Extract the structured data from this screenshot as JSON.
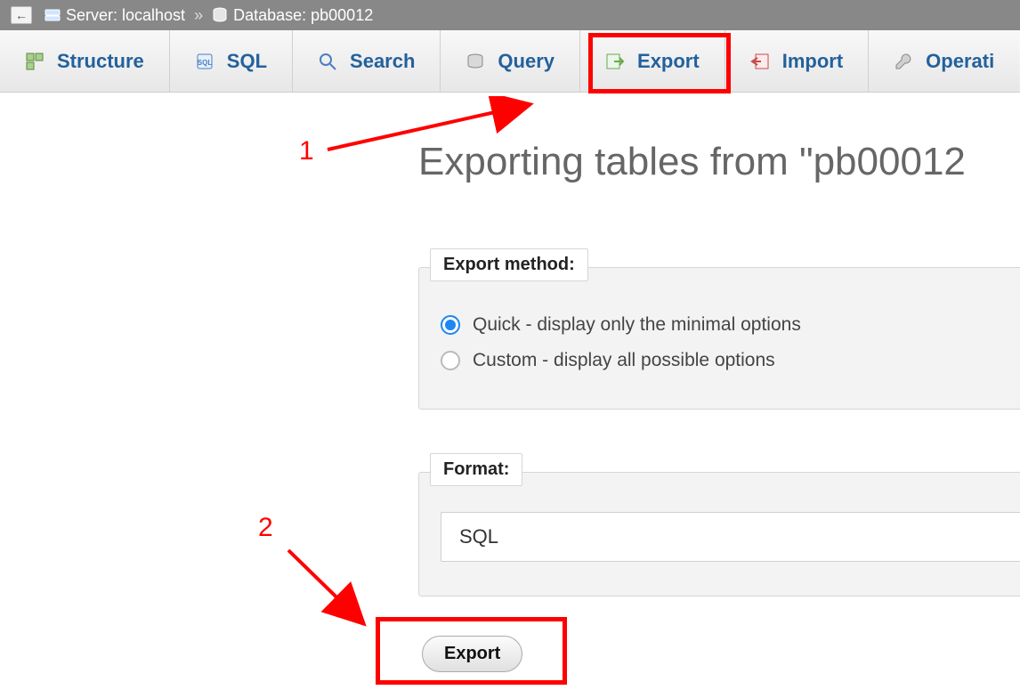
{
  "breadcrumb": {
    "server_label": "Server: localhost",
    "database_label": "Database: pb00012",
    "separator": "»"
  },
  "tabs": [
    {
      "id": "structure",
      "label": "Structure"
    },
    {
      "id": "sql",
      "label": "SQL"
    },
    {
      "id": "search",
      "label": "Search"
    },
    {
      "id": "query",
      "label": "Query"
    },
    {
      "id": "export",
      "label": "Export"
    },
    {
      "id": "import",
      "label": "Import"
    },
    {
      "id": "operations",
      "label": "Operati"
    }
  ],
  "page": {
    "title": "Exporting tables from \"pb00012"
  },
  "export_method": {
    "legend": "Export method:",
    "options": [
      {
        "id": "quick",
        "label": "Quick - display only the minimal options",
        "checked": true
      },
      {
        "id": "custom",
        "label": "Custom - display all possible options",
        "checked": false
      }
    ]
  },
  "format": {
    "legend": "Format:",
    "selected": "SQL"
  },
  "actions": {
    "export_button": "Export"
  },
  "annotations": {
    "step1": "1",
    "step2": "2"
  }
}
